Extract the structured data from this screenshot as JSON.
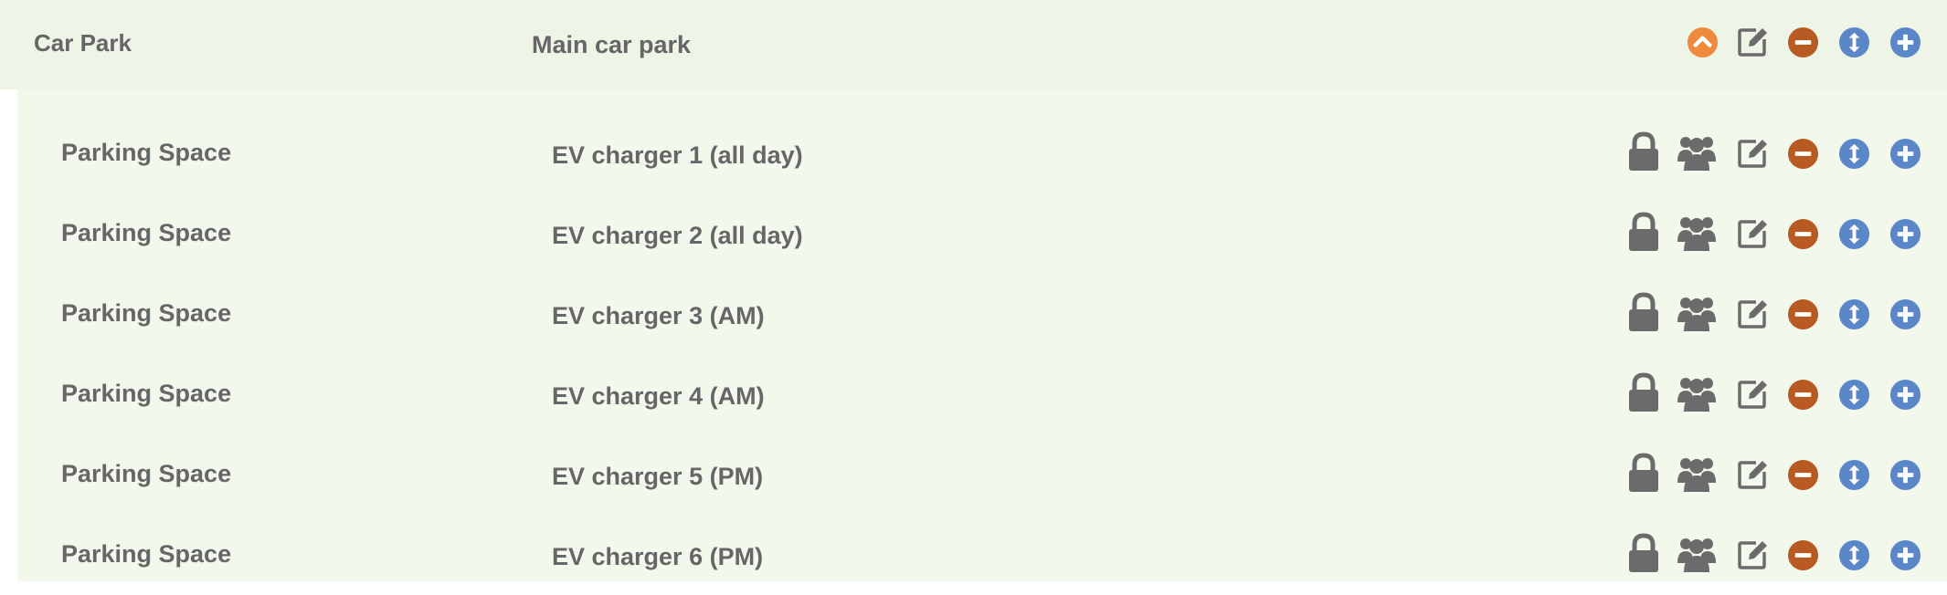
{
  "parent": {
    "type_label": "Car Park",
    "name": "Main car park",
    "actions": [
      "collapse-icon",
      "edit-icon",
      "remove-icon",
      "reorder-icon",
      "add-icon"
    ]
  },
  "children": [
    {
      "type_label": "Parking Space",
      "name": "EV charger 1 (all day)"
    },
    {
      "type_label": "Parking Space",
      "name": "EV charger 2 (all day)"
    },
    {
      "type_label": "Parking Space",
      "name": "EV charger 3 (AM)"
    },
    {
      "type_label": "Parking Space",
      "name": "EV charger 4 (AM)"
    },
    {
      "type_label": "Parking Space",
      "name": "EV charger 5 (PM)"
    },
    {
      "type_label": "Parking Space",
      "name": "EV charger 6 (PM)"
    }
  ],
  "child_actions": [
    "lock-icon",
    "users-icon",
    "edit-icon",
    "remove-icon",
    "reorder-icon",
    "add-icon"
  ],
  "colors": {
    "collapse": "#ee8a3c",
    "remove": "#b85a24",
    "reorder": "#5b86c8",
    "add": "#5b86c8",
    "icon_gray": "#6b6b6b",
    "parent_bg": "#eef4e6",
    "child_bg": "#f3f8ed"
  }
}
